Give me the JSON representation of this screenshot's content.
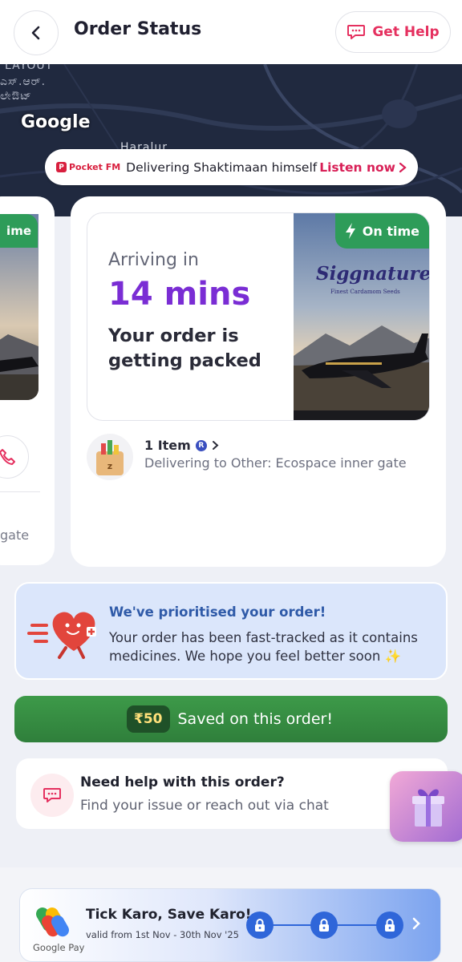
{
  "header": {
    "title": "Order Status",
    "help_label": "Get Help"
  },
  "map": {
    "labels": [
      "LAYOUT",
      "ಎಸ್.ಆರ್.",
      "ಲೇಔಟ್",
      "Haralur"
    ],
    "provider": "Google"
  },
  "promo": {
    "brand": "Pocket FM",
    "text": "Delivering Shaktimaan himself",
    "cta": "Listen now"
  },
  "side_card": {
    "badge": "ime",
    "gate_text": "gate"
  },
  "order": {
    "arriving_label": "Arriving in",
    "eta": "14 mins",
    "status": "Your order is getting packed",
    "ontime_label": "On time",
    "product_brand": "Siggnature",
    "product_tagline": "Finest Cardamom Seeds",
    "item_count": "1 Item",
    "delivering_to": "Delivering to Other: Ecospace inner gate"
  },
  "priority": {
    "title": "We've prioritised your order!",
    "body": "Your order has been fast-tracked as it contains medicines. We hope you feel better soon ✨"
  },
  "savings": {
    "amount": "₹50",
    "text": "Saved on this order!"
  },
  "help": {
    "title": "Need help with this order?",
    "subtitle": "Find your issue or reach out via chat"
  },
  "gpay": {
    "brand": "Google Pay",
    "title": "Tick Karo, Save Karo!",
    "validity": "valid from 1st Nov - 30th Nov '25"
  },
  "colors": {
    "accent_pink": "#e5305f",
    "eta_purple": "#7a2dd4",
    "ontime_green": "#2e9c59",
    "saved_green": "#3d9a49",
    "priority_blue": "#2f5aa8"
  }
}
